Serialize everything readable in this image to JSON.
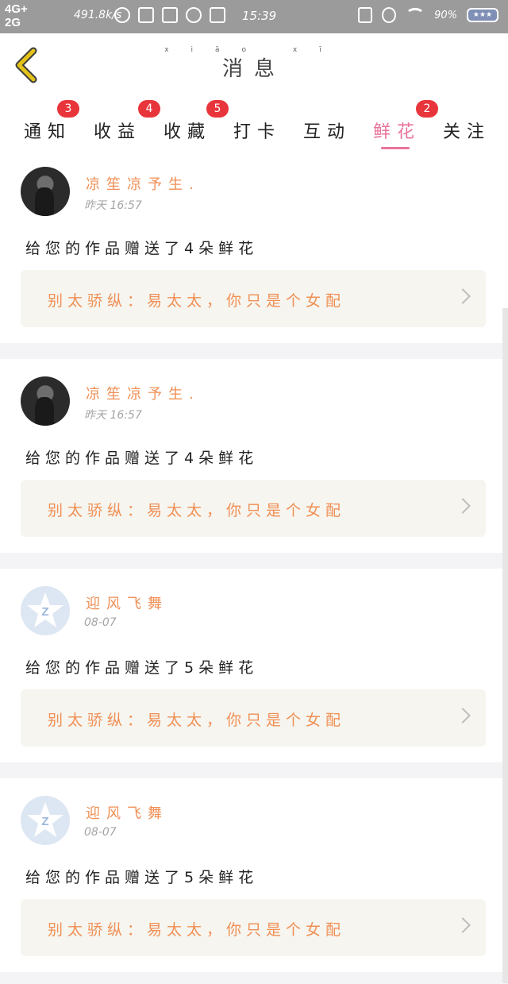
{
  "status_bar": {
    "network_1": "4G+",
    "network_2": "2G",
    "speed": "491.8k/s",
    "time": "15:39",
    "battery": "90%"
  },
  "header": {
    "title": "消息",
    "title_pinyin": "xiāo xī"
  },
  "tabs": [
    {
      "label": "通知",
      "badge": "3",
      "active": false
    },
    {
      "label": "收益",
      "badge": "4",
      "active": false
    },
    {
      "label": "收藏",
      "badge": "5",
      "active": false
    },
    {
      "label": "打卡",
      "badge": "",
      "active": false
    },
    {
      "label": "互动",
      "badge": "",
      "active": false
    },
    {
      "label": "鲜花",
      "badge": "2",
      "active": true
    },
    {
      "label": "关注",
      "badge": "",
      "active": false
    }
  ],
  "messages": [
    {
      "user": "凉笙凉予生.",
      "time": "昨天 16:57",
      "text": "给您的作品赠送了4朵鲜花",
      "quote": "别太骄纵：易太太，你只是个女配",
      "avatar": "photo"
    },
    {
      "user": "凉笙凉予生.",
      "time": "昨天 16:57",
      "text": "给您的作品赠送了4朵鲜花",
      "quote": "别太骄纵：易太太，你只是个女配",
      "avatar": "photo"
    },
    {
      "user": "迎风飞舞",
      "time": "08-07",
      "text": "给您的作品赠送了5朵鲜花",
      "quote": "别太骄纵：易太太，你只是个女配",
      "avatar": "qq-default"
    },
    {
      "user": "迎风飞舞",
      "time": "08-07",
      "text": "给您的作品赠送了5朵鲜花",
      "quote": "别太骄纵：易太太，你只是个女配",
      "avatar": "qq-default"
    }
  ],
  "colors": {
    "accent": "#e8739c",
    "badge": "#e8353b",
    "username": "#f08f55",
    "back_arrow": "#e2c21b"
  }
}
